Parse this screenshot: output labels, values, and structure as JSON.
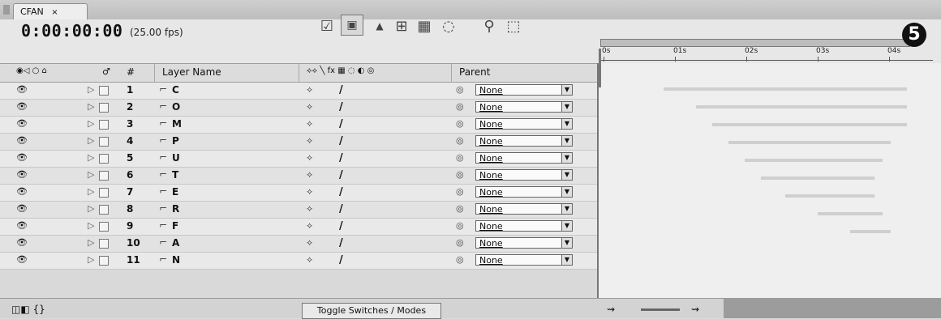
{
  "tab": {
    "title": "CFAN",
    "close": "×"
  },
  "timecode": "0:00:00:00",
  "fps": "(25.00 fps)",
  "ruler": {
    "labels": [
      "0s",
      "01s",
      "02s",
      "03s",
      "04s"
    ]
  },
  "badge": "5",
  "columns": {
    "layer_name": "Layer Name",
    "number": "#",
    "parent": "Parent"
  },
  "layers": [
    {
      "num": "1",
      "name": "C",
      "parent": "None"
    },
    {
      "num": "2",
      "name": "O",
      "parent": "None"
    },
    {
      "num": "3",
      "name": "M",
      "parent": "None"
    },
    {
      "num": "4",
      "name": "P",
      "parent": "None"
    },
    {
      "num": "5",
      "name": "U",
      "parent": "None"
    },
    {
      "num": "6",
      "name": "T",
      "parent": "None"
    },
    {
      "num": "7",
      "name": "E",
      "parent": "None"
    },
    {
      "num": "8",
      "name": "R",
      "parent": "None"
    },
    {
      "num": "9",
      "name": "F",
      "parent": "None"
    },
    {
      "num": "10",
      "name": "A",
      "parent": "None"
    },
    {
      "num": "11",
      "name": "N",
      "parent": "None"
    }
  ],
  "footer": {
    "toggle_label": "Toggle Switches / Modes"
  }
}
